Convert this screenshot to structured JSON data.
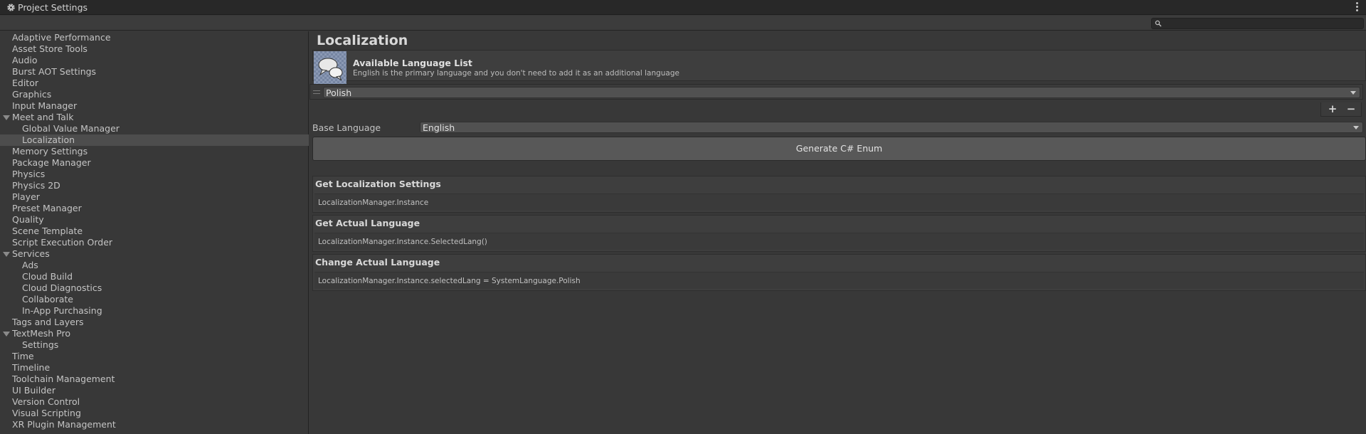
{
  "window": {
    "title": "Project Settings",
    "title_icon": "gear-icon",
    "menu_icon": "kebab-menu-icon"
  },
  "search": {
    "placeholder": "",
    "value": "",
    "icon": "search-icon"
  },
  "sidebar": {
    "items": [
      {
        "label": "Adaptive Performance",
        "level": 0
      },
      {
        "label": "Asset Store Tools",
        "level": 0
      },
      {
        "label": "Audio",
        "level": 0
      },
      {
        "label": "Burst AOT Settings",
        "level": 0
      },
      {
        "label": "Editor",
        "level": 0
      },
      {
        "label": "Graphics",
        "level": 0
      },
      {
        "label": "Input Manager",
        "level": 0
      },
      {
        "label": "Meet and Talk",
        "level": 0,
        "expanded": true
      },
      {
        "label": "Global Value Manager",
        "level": 1
      },
      {
        "label": "Localization",
        "level": 1,
        "selected": true
      },
      {
        "label": "Memory Settings",
        "level": 0
      },
      {
        "label": "Package Manager",
        "level": 0
      },
      {
        "label": "Physics",
        "level": 0
      },
      {
        "label": "Physics 2D",
        "level": 0
      },
      {
        "label": "Player",
        "level": 0
      },
      {
        "label": "Preset Manager",
        "level": 0
      },
      {
        "label": "Quality",
        "level": 0
      },
      {
        "label": "Scene Template",
        "level": 0
      },
      {
        "label": "Script Execution Order",
        "level": 0
      },
      {
        "label": "Services",
        "level": 0,
        "expanded": true
      },
      {
        "label": "Ads",
        "level": 1
      },
      {
        "label": "Cloud Build",
        "level": 1
      },
      {
        "label": "Cloud Diagnostics",
        "level": 1
      },
      {
        "label": "Collaborate",
        "level": 1
      },
      {
        "label": "In-App Purchasing",
        "level": 1
      },
      {
        "label": "Tags and Layers",
        "level": 0
      },
      {
        "label": "TextMesh Pro",
        "level": 0,
        "expanded": true
      },
      {
        "label": "Settings",
        "level": 1
      },
      {
        "label": "Time",
        "level": 0
      },
      {
        "label": "Timeline",
        "level": 0
      },
      {
        "label": "Toolchain Management",
        "level": 0
      },
      {
        "label": "UI Builder",
        "level": 0
      },
      {
        "label": "Version Control",
        "level": 0
      },
      {
        "label": "Visual Scripting",
        "level": 0
      },
      {
        "label": "XR Plugin Management",
        "level": 0
      }
    ]
  },
  "main": {
    "title": "Localization",
    "language_header": {
      "title": "Available Language List",
      "subtitle": "English is the primary language and you don't need to add it as an additional language",
      "icon": "speech-bubbles-icon"
    },
    "language_list": [
      "Polish"
    ],
    "add_button": "+",
    "remove_button": "−",
    "base_language": {
      "label": "Base Language",
      "value": "English"
    },
    "generate_button": "Generate C# Enum",
    "sections": [
      {
        "title": "Get Localization Settings",
        "code": "LocalizationManager.Instance"
      },
      {
        "title": "Get Actual Language",
        "code": "LocalizationManager.Instance.SelectedLang()"
      },
      {
        "title": "Change Actual Language",
        "code": "LocalizationManager.Instance.selectedLang = SystemLanguage.Polish"
      }
    ]
  },
  "colors": {
    "background": "#383838",
    "titlebar": "#282828",
    "selected_row": "#4d4d4d",
    "button": "#585858",
    "icon_tile": "#6f7f9b"
  }
}
